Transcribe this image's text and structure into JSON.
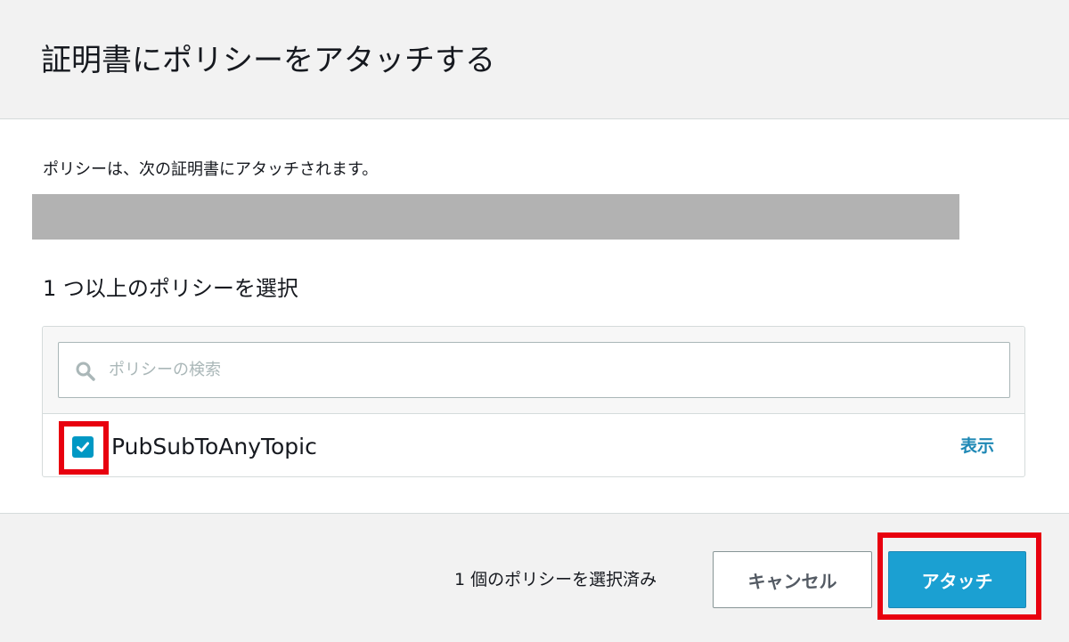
{
  "dialog": {
    "title": "証明書にポリシーをアタッチする"
  },
  "body": {
    "description": "ポリシーは、次の証明書にアタッチされます。",
    "section_heading": "1 つ以上のポリシーを選択",
    "search": {
      "placeholder": "ポリシーの検索",
      "value": "",
      "icon": "search-icon"
    },
    "policies": [
      {
        "name": "PubSubToAnyTopic",
        "checked": true,
        "view_label": "表示"
      }
    ]
  },
  "footer": {
    "selection_count": "1 個のポリシーを選択済み",
    "cancel_label": "キャンセル",
    "attach_label": "アタッチ"
  },
  "colors": {
    "accent": "#1ba0d2",
    "link": "#1e88b5",
    "highlight": "#e8000f",
    "redacted": "#b2b2b2"
  }
}
